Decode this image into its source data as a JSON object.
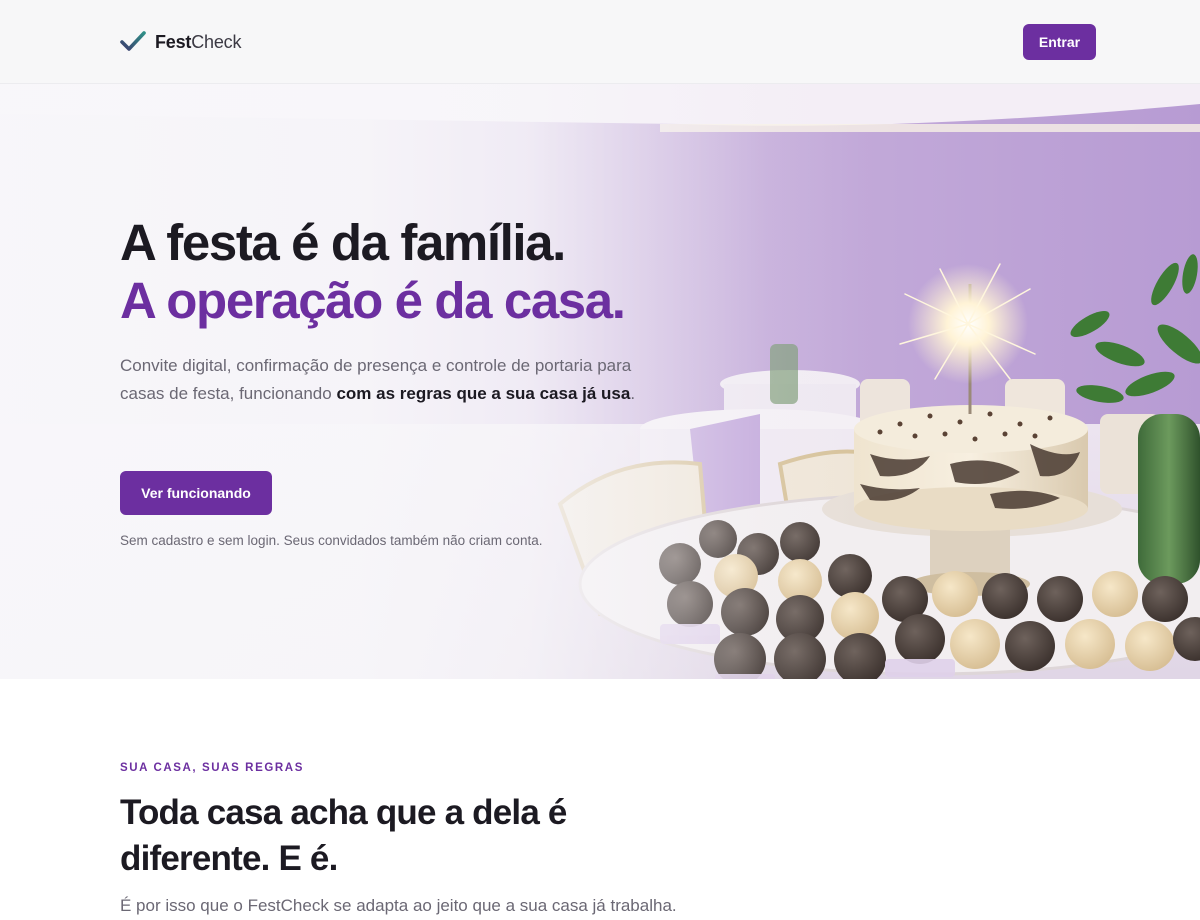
{
  "header": {
    "brand_bold": "Fest",
    "brand_light": "Check",
    "login_label": "Entrar"
  },
  "hero": {
    "title_line1": "A festa é da família.",
    "title_line2": "A operação é da casa.",
    "lead_text": "Convite digital, confirmação de presença e controle de portaria para casas de festa, funcionando ",
    "lead_bold": "com as regras que a sua casa já usa",
    "lead_end": ".",
    "cta_label": "Ver funcionando",
    "note": "Sem cadastro e sem login. Seus convidados também não criam conta."
  },
  "section": {
    "eyebrow": "SUA CASA, SUAS REGRAS",
    "title": "Toda casa acha que a dela é diferente. E é.",
    "text": "É por isso que o FestCheck se adapta ao jeito que a sua casa já trabalha."
  },
  "colors": {
    "brand_purple": "#6c2fa0",
    "check_gradient_start": "#2f8f87",
    "check_gradient_end": "#3b3d6e",
    "text_dark": "#1c1a22",
    "text_muted": "#6b6874"
  },
  "icons": {
    "logo": "check-icon"
  }
}
